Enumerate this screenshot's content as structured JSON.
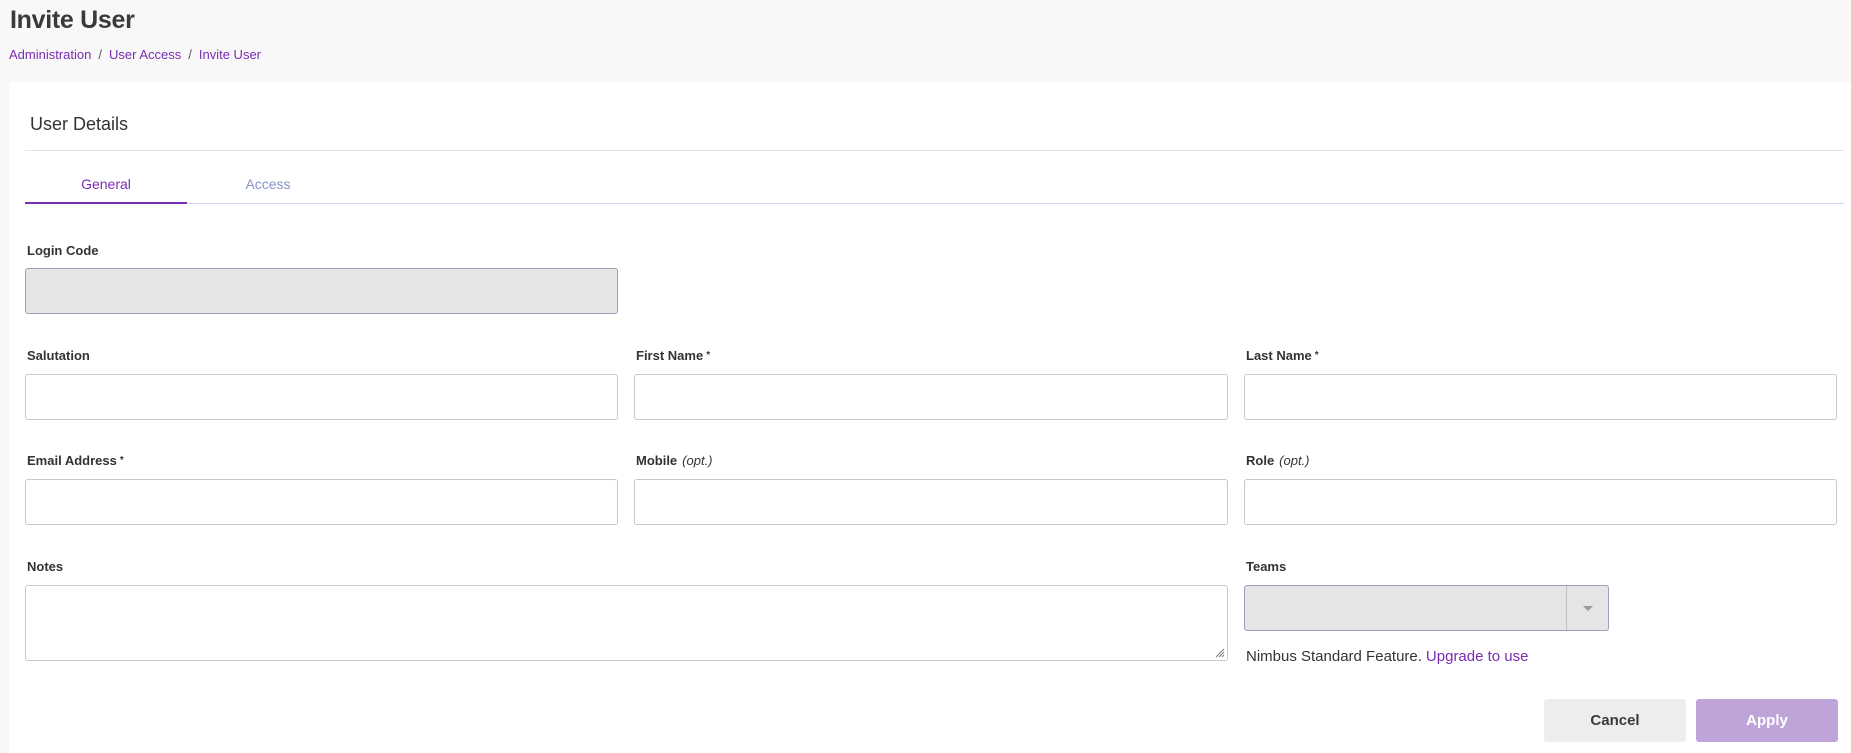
{
  "header": {
    "title": "Invite User",
    "breadcrumb": [
      "Administration",
      "User Access",
      "Invite User"
    ],
    "separator": "/"
  },
  "form": {
    "section_title": "User Details",
    "tabs": [
      {
        "label": "General",
        "active": true
      },
      {
        "label": "Access",
        "active": false
      }
    ],
    "fields": {
      "login_code": {
        "label": "Login Code",
        "value": "",
        "disabled": true
      },
      "salutation": {
        "label": "Salutation",
        "value": ""
      },
      "first_name": {
        "label": "First Name",
        "required_mark": "*",
        "value": ""
      },
      "last_name": {
        "label": "Last Name",
        "required_mark": "*",
        "value": ""
      },
      "email": {
        "label": "Email Address",
        "required_mark": "*",
        "value": ""
      },
      "mobile": {
        "label": "Mobile",
        "optional_text": "(opt.)",
        "value": ""
      },
      "role": {
        "label": "Role",
        "optional_text": "(opt.)",
        "value": ""
      },
      "notes": {
        "label": "Notes",
        "value": ""
      },
      "teams": {
        "label": "Teams",
        "value": "",
        "disabled": true
      }
    },
    "upgrade": {
      "text": "Nimbus Standard Feature.",
      "link": "Upgrade to use"
    },
    "actions": {
      "cancel": "Cancel",
      "apply": "Apply"
    }
  },
  "colors": {
    "accent": "#7a2db0",
    "apply_disabled": "#bfa4d9",
    "tab_inactive": "#8b94c4",
    "disabled_input": "#e5e5e5"
  }
}
